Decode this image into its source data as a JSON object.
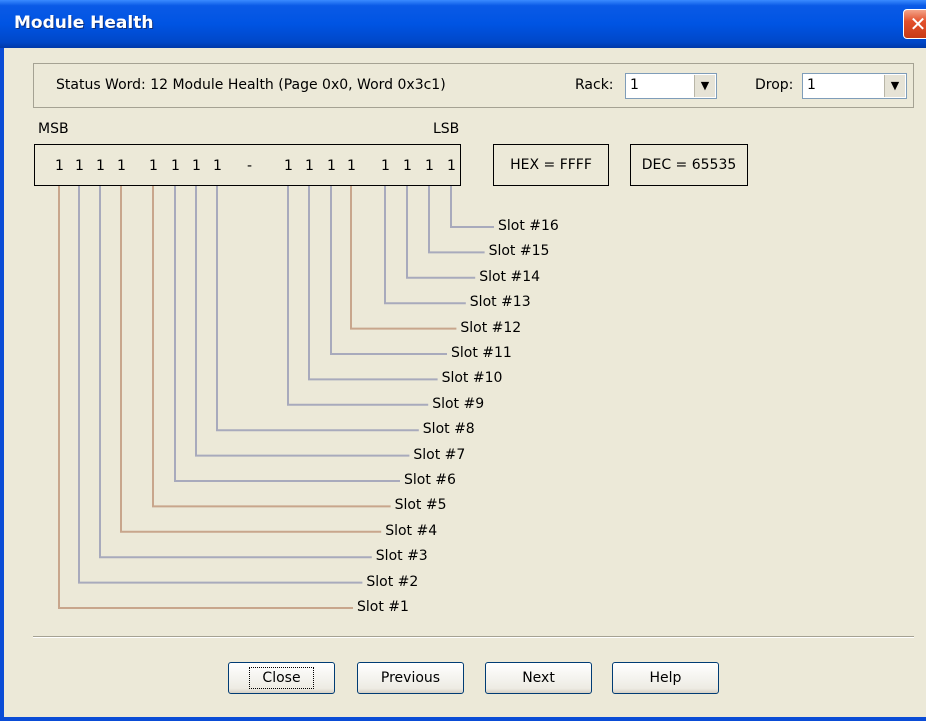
{
  "window": {
    "title": "Module Health",
    "close_glyph": "✕"
  },
  "header": {
    "status_text": "Status Word: 12  Module Health  (Page 0x0, Word 0x3c1)",
    "rack_label": "Rack:",
    "rack_value": "1",
    "drop_label": "Drop:",
    "drop_value": "1"
  },
  "word": {
    "msb_label": "MSB",
    "lsb_label": "LSB",
    "bits": [
      "1",
      "1",
      "1",
      "1",
      "1",
      "1",
      "1",
      "1",
      "1",
      "1",
      "1",
      "1",
      "1",
      "1",
      "1",
      "1"
    ],
    "separator": "-",
    "hex_text": "HEX =  FFFF",
    "dec_text": "DEC = 65535"
  },
  "slots": [
    "Slot #1",
    "Slot #2",
    "Slot #3",
    "Slot #4",
    "Slot #5",
    "Slot #6",
    "Slot #7",
    "Slot #8",
    "Slot #9",
    "Slot #10",
    "Slot #11",
    "Slot #12",
    "Slot #13",
    "Slot #14",
    "Slot #15",
    "Slot #16"
  ],
  "lead_colors": [
    "#C8A68C",
    "#A8AABC",
    "#A8AABC",
    "#C8A68C",
    "#C8A68C",
    "#A8AABC",
    "#A8AABC",
    "#A8AABC",
    "#A8AABC",
    "#A8AABC",
    "#A8AABC",
    "#C8A68C",
    "#A8AABC",
    "#A8AABC",
    "#A8AABC",
    "#A8AABC"
  ],
  "buttons": {
    "close": "Close",
    "previous": "Previous",
    "next": "Next",
    "help": "Help"
  },
  "icons": {
    "dropdown": "chevron-down-icon"
  }
}
